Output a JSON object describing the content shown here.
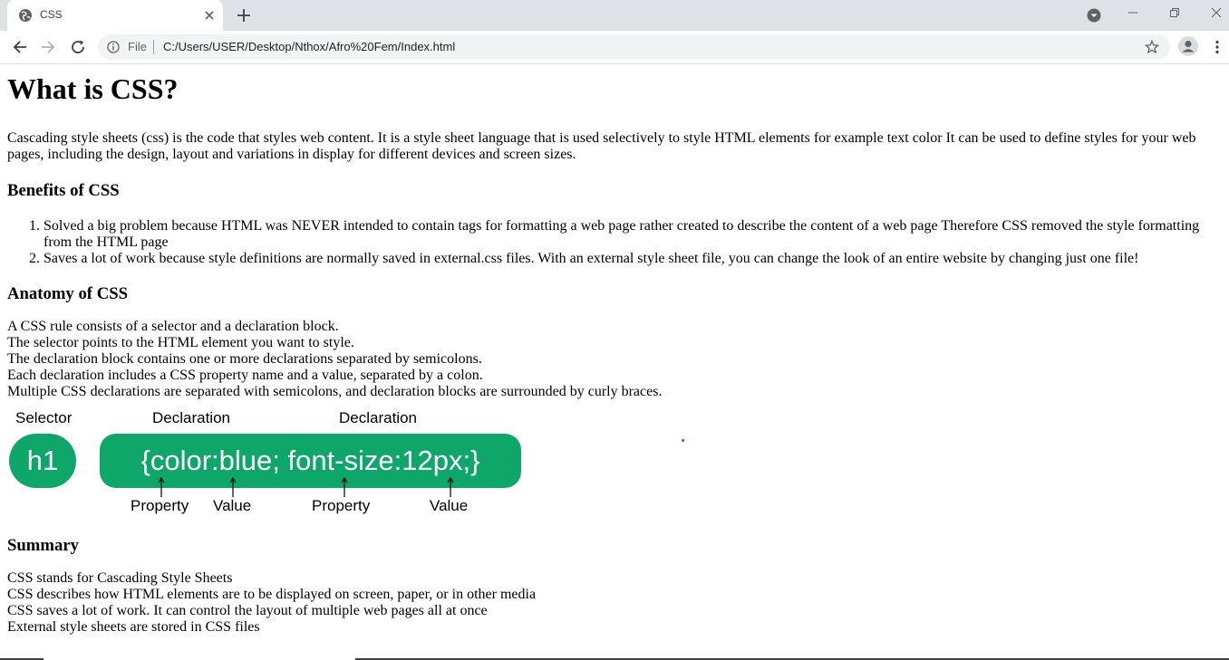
{
  "browser": {
    "tab_title": "CSS",
    "scheme_label": "File",
    "url": "C:/Users/USER/Desktop/Nthox/Afro%20Fem/Index.html"
  },
  "page": {
    "heading": "What is CSS?",
    "intro": "Cascading style sheets (css) is the code that styles web content. It is a style sheet language that is used selectively to style HTML elements for example text color It can be used to define styles for your web pages, including the design, layout and variations in display for different devices and screen sizes.",
    "benefits_heading": "Benefits of CSS",
    "benefits": [
      "Solved a big problem because HTML was NEVER intended to contain tags for formatting a web page rather created to describe the content of a web page Therefore CSS removed the style formatting from the HTML page",
      "Saves a lot of work because style definitions are normally saved in external.css files. With an external style sheet file, you can change the look of an entire website by changing just one file!"
    ],
    "anatomy_heading": "Anatomy of CSS",
    "anatomy_lines": [
      "A CSS rule consists of a selector and a declaration block.",
      "The selector points to the HTML element you want to style.",
      "The declaration block contains one or more declarations separated by semicolons.",
      "Each declaration includes a CSS property name and a value, separated by a colon.",
      "Multiple CSS declarations are separated with semicolons, and declaration blocks are surrounded by curly braces."
    ],
    "diagram": {
      "selector_label": "Selector",
      "declaration_label_1": "Declaration",
      "declaration_label_2": "Declaration",
      "selector_text": "h1",
      "declaration_text": "{color:blue; font-size:12px;}",
      "property_label_1": "Property",
      "value_label_1": "Value",
      "property_label_2": "Property",
      "value_label_2": "Value",
      "pill_color": "#0fa66a"
    },
    "summary_heading": "Summary",
    "summary_lines": [
      "CSS stands for Cascading Style Sheets",
      "CSS describes how HTML elements are to be displayed on screen, paper, or in other media",
      "CSS saves a lot of work. It can control the layout of multiple web pages all at once",
      "External style sheets are stored in CSS files"
    ]
  }
}
